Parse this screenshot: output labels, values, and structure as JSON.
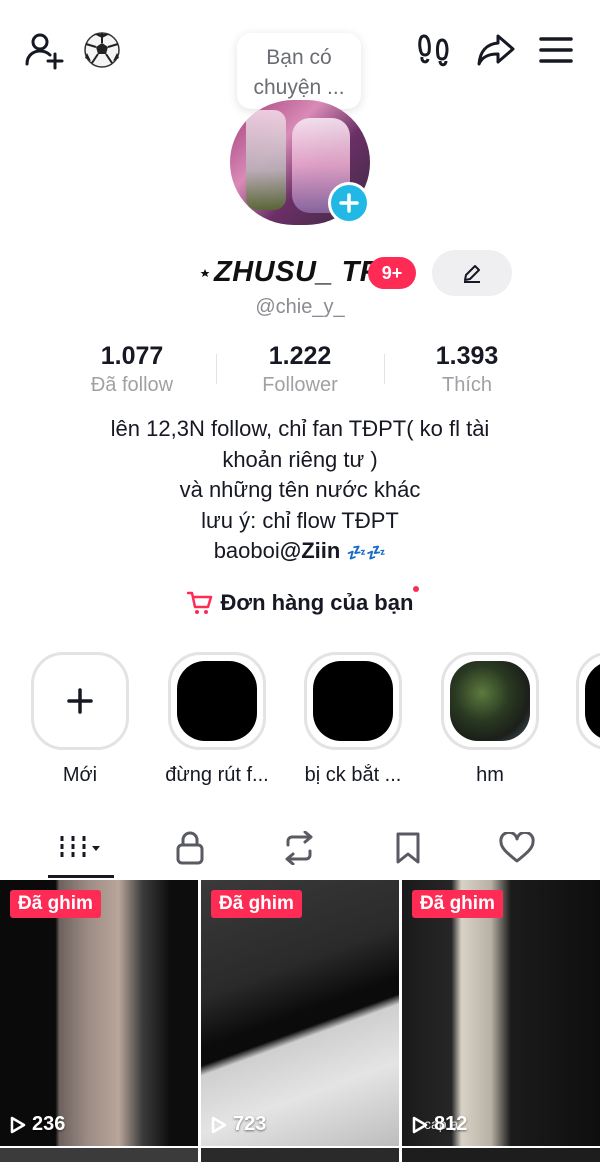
{
  "header": {
    "icons": [
      "add-friend-icon",
      "soccer-ball-icon",
      "footprints-icon",
      "share-icon",
      "menu-icon"
    ],
    "note_bubble": "Bạn có chuyện ..."
  },
  "profile": {
    "name": "ZHUSU_ TF",
    "badge": "9+",
    "username": "@chie_y_"
  },
  "stats": [
    {
      "value": "1.077",
      "label": "Đã follow"
    },
    {
      "value": "1.222",
      "label": "Follower"
    },
    {
      "value": "1.393",
      "label": "Thích"
    }
  ],
  "bio": {
    "line1": "lên 12,3N follow, chỉ fan TĐPT( ko fl tài",
    "line2": "khoản riêng tư )",
    "line3": "và những tên nước khác",
    "line4": "lưu ý: chỉ flow TĐPT",
    "line5_prefix": "baoboi",
    "line5_mention": "@Ziin",
    "line5_emoji": "💤💤"
  },
  "orders": {
    "label": "Đơn hàng của bạn"
  },
  "highlights": [
    {
      "label": "Mới"
    },
    {
      "label": "đừng rút f..."
    },
    {
      "label": "bị ck bắt ..."
    },
    {
      "label": "hm"
    }
  ],
  "tabs": [
    "videos-grid-icon",
    "lock-icon",
    "repost-icon",
    "bookmark-icon",
    "heart-icon"
  ],
  "videos": [
    {
      "pinned_label": "Đã ghim",
      "views": "236"
    },
    {
      "pinned_label": "Đã ghim",
      "views": "723"
    },
    {
      "pinned_label": "Đã ghim",
      "views": "812",
      "caption": "cap ạ"
    }
  ],
  "colors": {
    "accent": "#fe2c55",
    "avatar_add": "#21b8e6",
    "text": "#161823",
    "muted": "#8a8b91"
  }
}
